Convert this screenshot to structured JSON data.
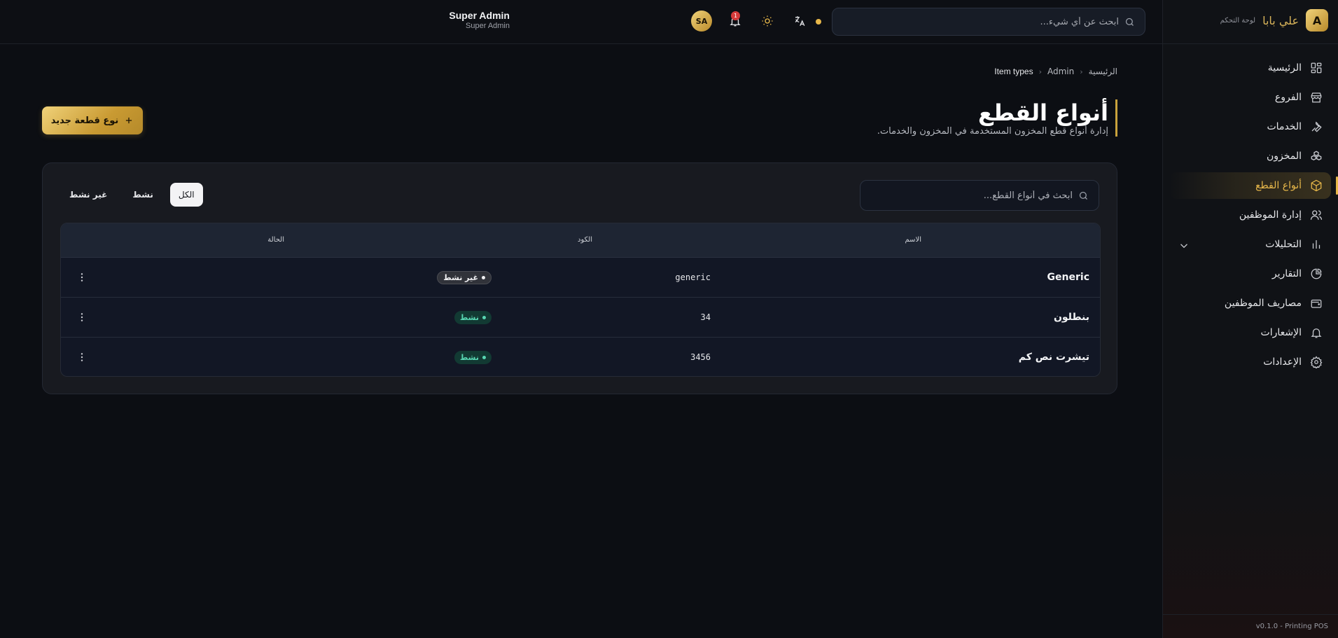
{
  "brand": {
    "logo_letter": "A",
    "name": "علي بابا",
    "subtitle": "لوحة التحكم"
  },
  "sidebar": {
    "items": [
      {
        "label": "الرئيسية",
        "icon": "dashboard-icon"
      },
      {
        "label": "الفروع",
        "icon": "store-icon"
      },
      {
        "label": "الخدمات",
        "icon": "wrench-icon"
      },
      {
        "label": "المخزون",
        "icon": "boxes-icon"
      },
      {
        "label": "أنواع القطع",
        "icon": "package-icon",
        "active": true
      },
      {
        "label": "إدارة الموظفين",
        "icon": "users-icon"
      },
      {
        "label": "التحليلات",
        "icon": "chart-icon",
        "expandable": true
      },
      {
        "label": "التقارير",
        "icon": "pie-chart-icon"
      },
      {
        "label": "مصاريف الموظفين",
        "icon": "wallet-icon"
      },
      {
        "label": "الإشعارات",
        "icon": "bell-icon"
      },
      {
        "label": "الإعدادات",
        "icon": "gear-icon"
      }
    ],
    "footer": "v0.1.0 - Printing POS"
  },
  "topbar": {
    "search_placeholder": "ابحث عن أي شيء...",
    "notification_count": "1",
    "user": {
      "initials": "SA",
      "name": "Super Admin",
      "role": "Super Admin"
    }
  },
  "breadcrumb": [
    "الرئيسية",
    "Admin",
    "Item types"
  ],
  "page": {
    "title": "أنواع القطع",
    "description": "إدارة أنواع قطع المخزون المستخدمة في المخزون والخدمات.",
    "new_button": "نوع قطعة جديد"
  },
  "table": {
    "search_placeholder": "ابحث في أنواع القطع...",
    "filters": [
      "الكل",
      "نشط",
      "غير نشط"
    ],
    "active_filter": "الكل",
    "columns": {
      "name": "الاسم",
      "code": "الكود",
      "status": "الحالة"
    },
    "rows": [
      {
        "name": "Generic",
        "code": "generic",
        "status": "غير نشط",
        "status_type": "inactive"
      },
      {
        "name": "بنطلون",
        "code": "34",
        "status": "نشط",
        "status_type": "active"
      },
      {
        "name": "تيشرت نص كم",
        "code": "3456",
        "status": "نشط",
        "status_type": "active"
      }
    ]
  },
  "colors": {
    "accent": "#e8b84a",
    "background": "#0c0e13",
    "active_badge": "#58d6b2"
  }
}
